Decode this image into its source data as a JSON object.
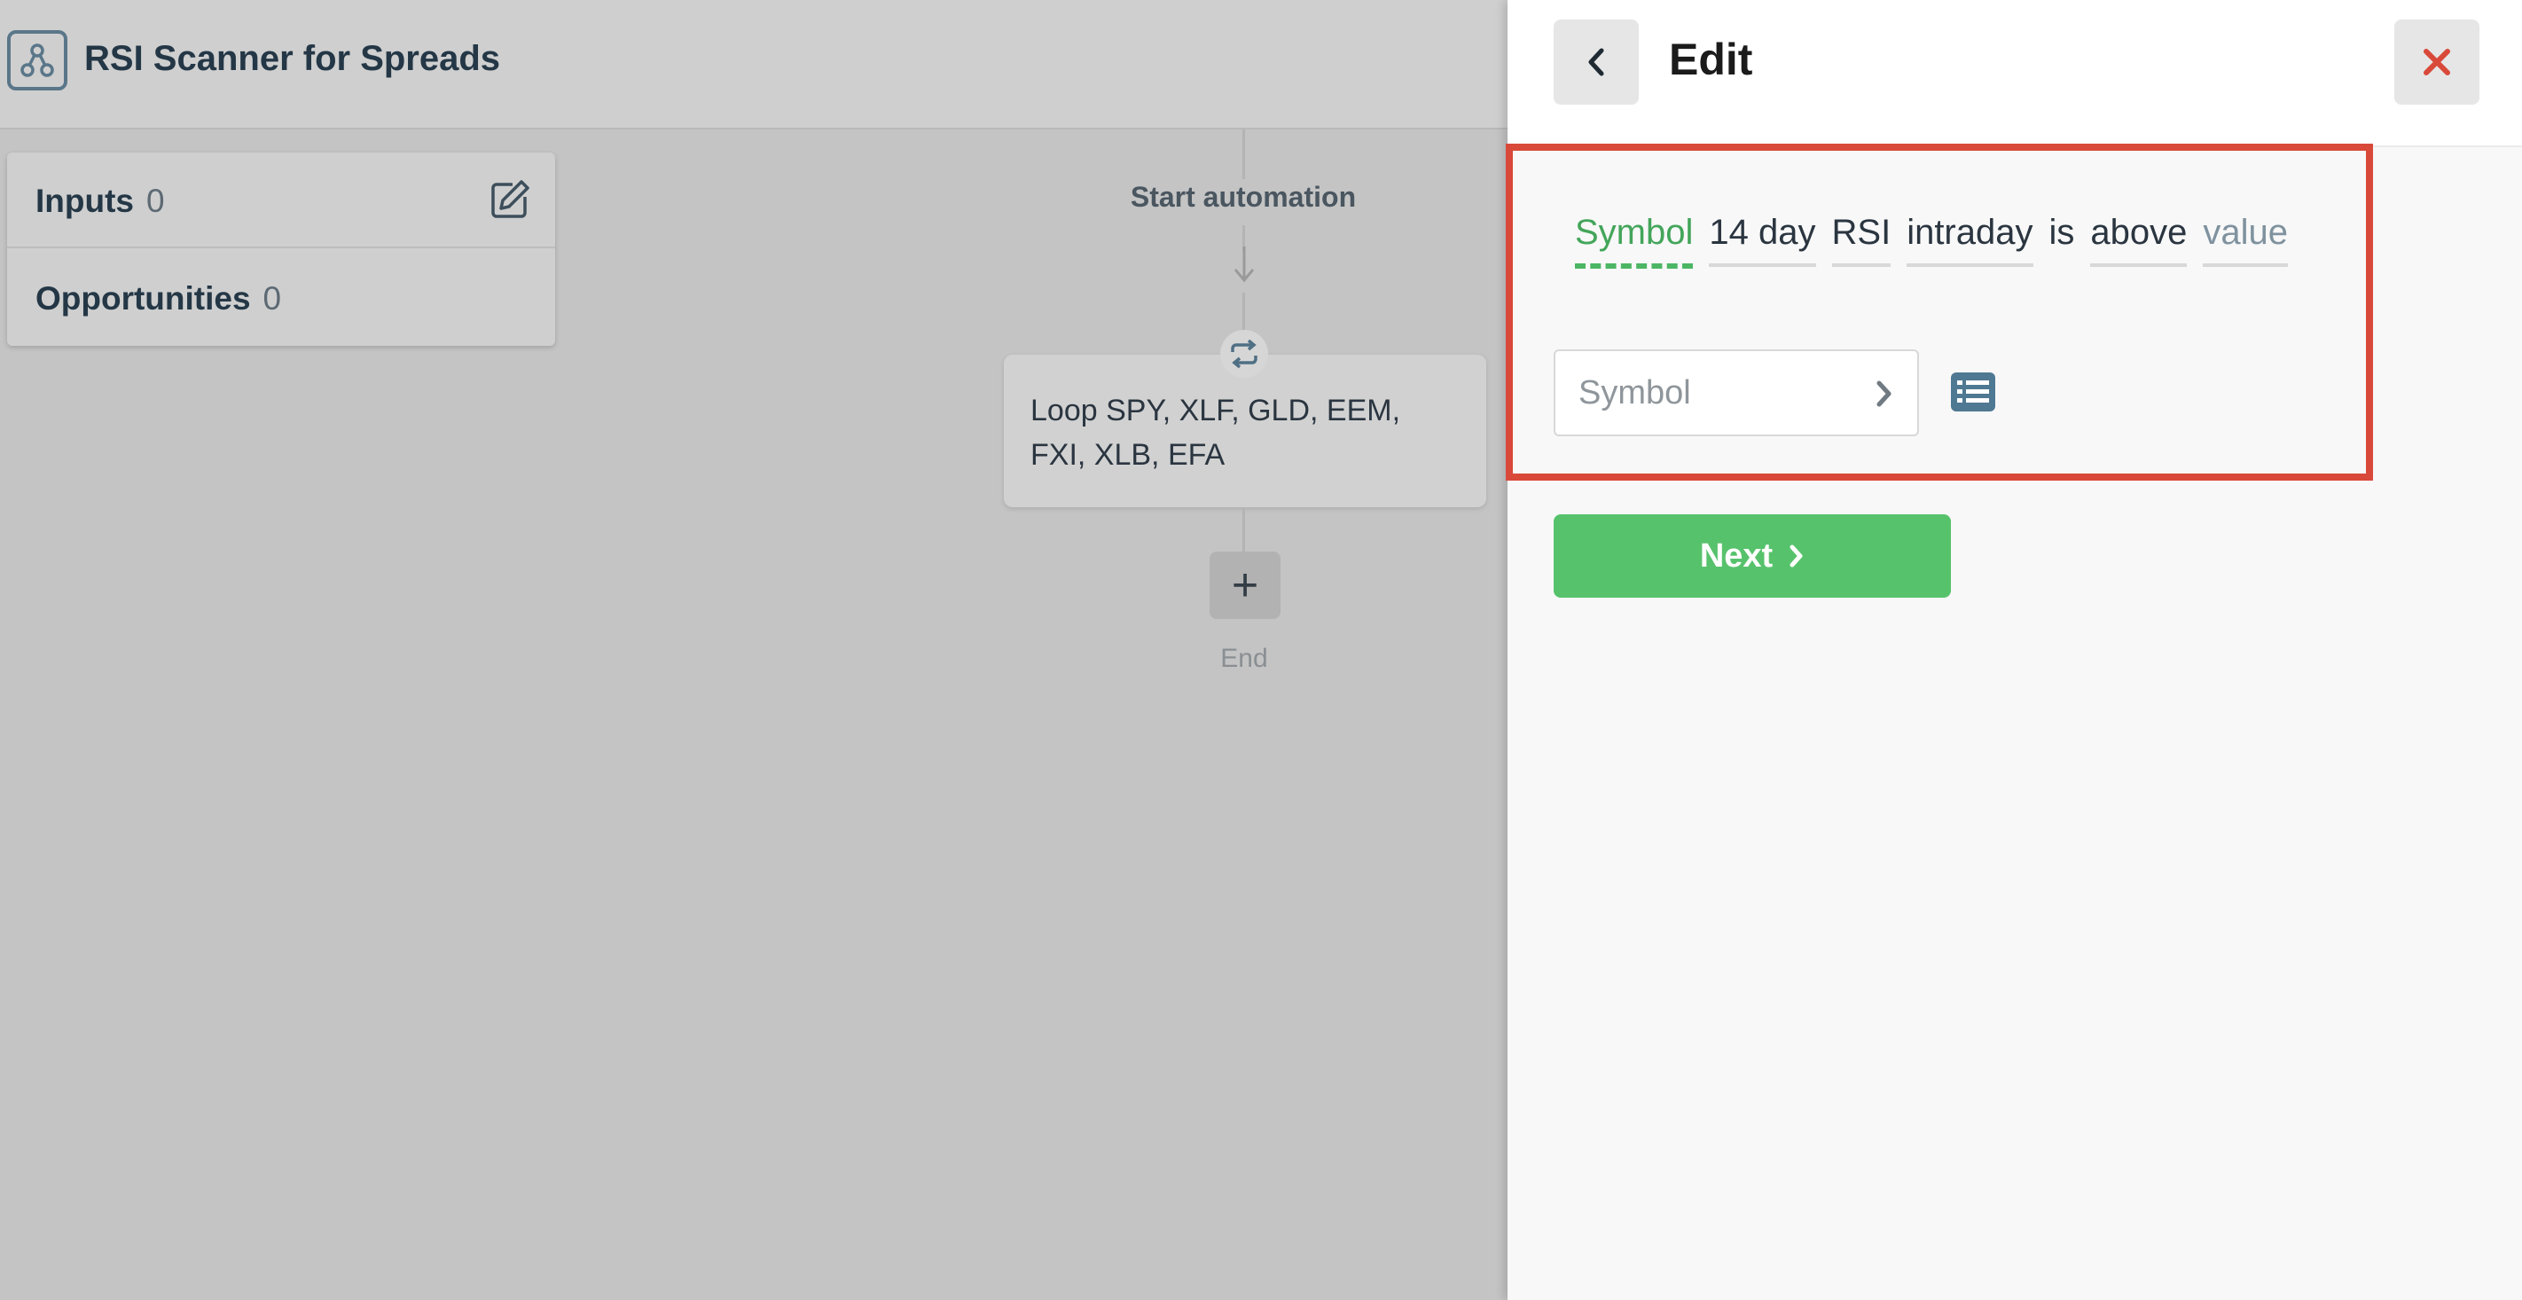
{
  "app": {
    "title": "RSI Scanner for Spreads",
    "icon": "workflow-icon"
  },
  "side_panel": {
    "items": [
      {
        "label": "Inputs",
        "count": "0",
        "icon": "edit-icon"
      },
      {
        "label": "Opportunities",
        "count": "0"
      }
    ]
  },
  "flow": {
    "start_label": "Start automation",
    "loop_text": "Loop SPY, XLF, GLD, EEM, FXI, XLB, EFA",
    "loop_icon": "repeat-icon",
    "add_icon": "plus-icon",
    "end_label": "End"
  },
  "edit_panel": {
    "title": "Edit",
    "back_icon": "chevron-left-icon",
    "close_icon": "close-icon",
    "sentence": [
      "Symbol",
      "14 day",
      "RSI",
      "intraday",
      "is",
      "above",
      "value"
    ],
    "symbol_select": {
      "placeholder": "Symbol",
      "icon": "chevron-right-icon"
    },
    "list_icon": "list-icon",
    "next_label": "Next"
  },
  "colors": {
    "accent_green": "#57c26c",
    "active_token": "#43a55a",
    "highlight_border": "#d9493a",
    "close_red": "#d9493a"
  }
}
